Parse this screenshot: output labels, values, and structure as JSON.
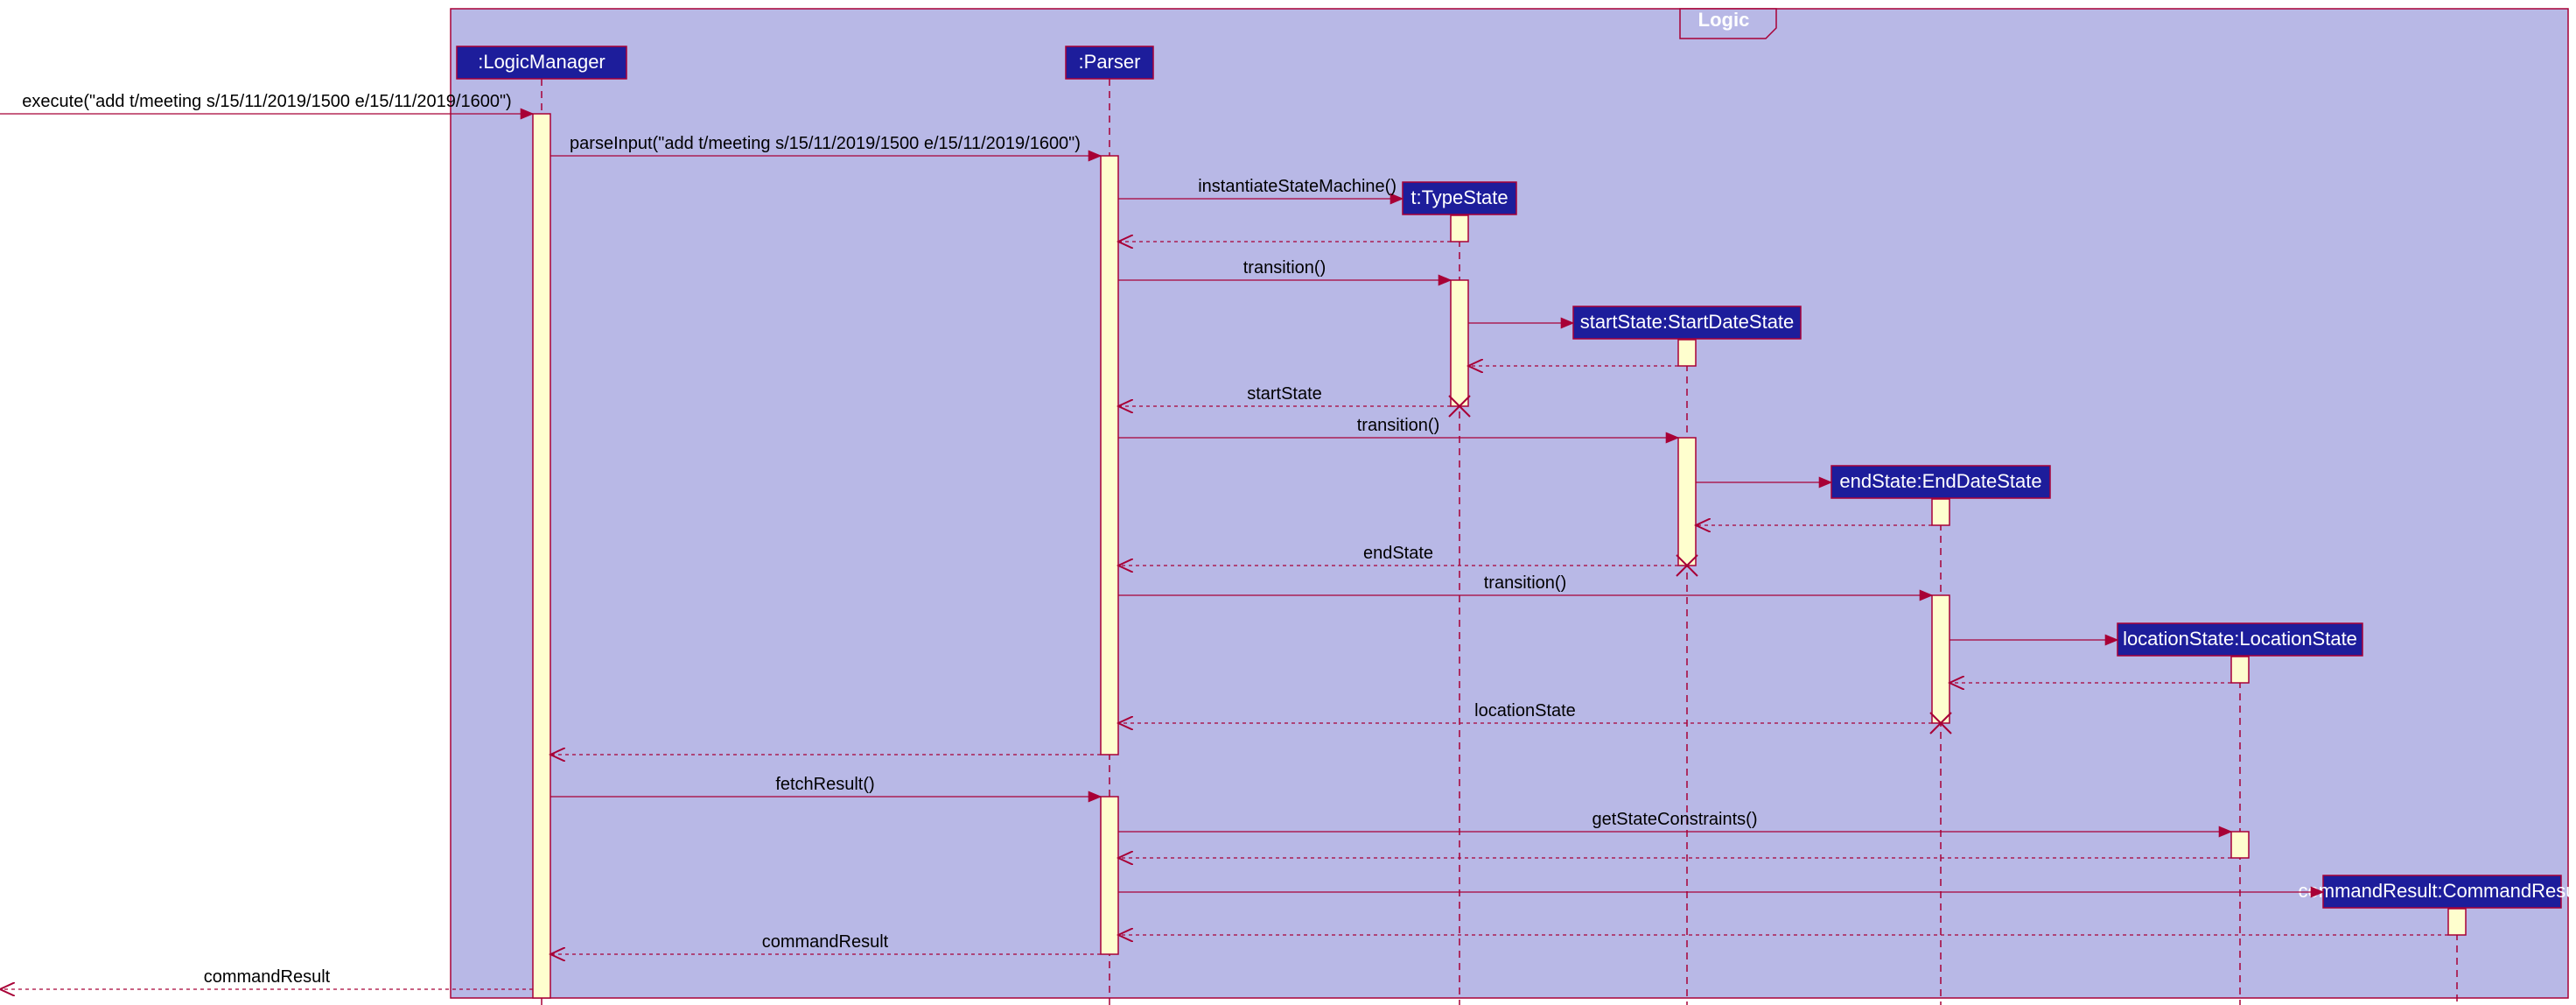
{
  "frame": {
    "label": "Logic"
  },
  "participants": {
    "logicManager": ":LogicManager",
    "parser": ":Parser",
    "typeState": "t:TypeState",
    "startDateState": "startState:StartDateState",
    "endDateState": "endState:EndDateState",
    "locationState": "locationState:LocationState",
    "commandResult": "commandResult:CommandResult"
  },
  "messages": {
    "execute": "execute(\"add t/meeting s/15/11/2019/1500 e/15/11/2019/1600\")",
    "parseInput": "parseInput(\"add t/meeting s/15/11/2019/1500 e/15/11/2019/1600\")",
    "instantiateStateMachine": "instantiateStateMachine()",
    "transition1": "transition()",
    "returnStartState": "startState",
    "transition2": "transition()",
    "returnEndState": "endState",
    "transition3": "transition()",
    "returnLocationState": "locationState",
    "fetchResult": "fetchResult()",
    "getStateConstraints": "getStateConstraints()",
    "returnCommandResult": "commandResult",
    "finalReturn": "commandResult"
  },
  "colors": {
    "participantFill": "#1d1d9b",
    "frameFill": "#b8b8e6",
    "line": "#a80036",
    "activation": "#fefece"
  }
}
